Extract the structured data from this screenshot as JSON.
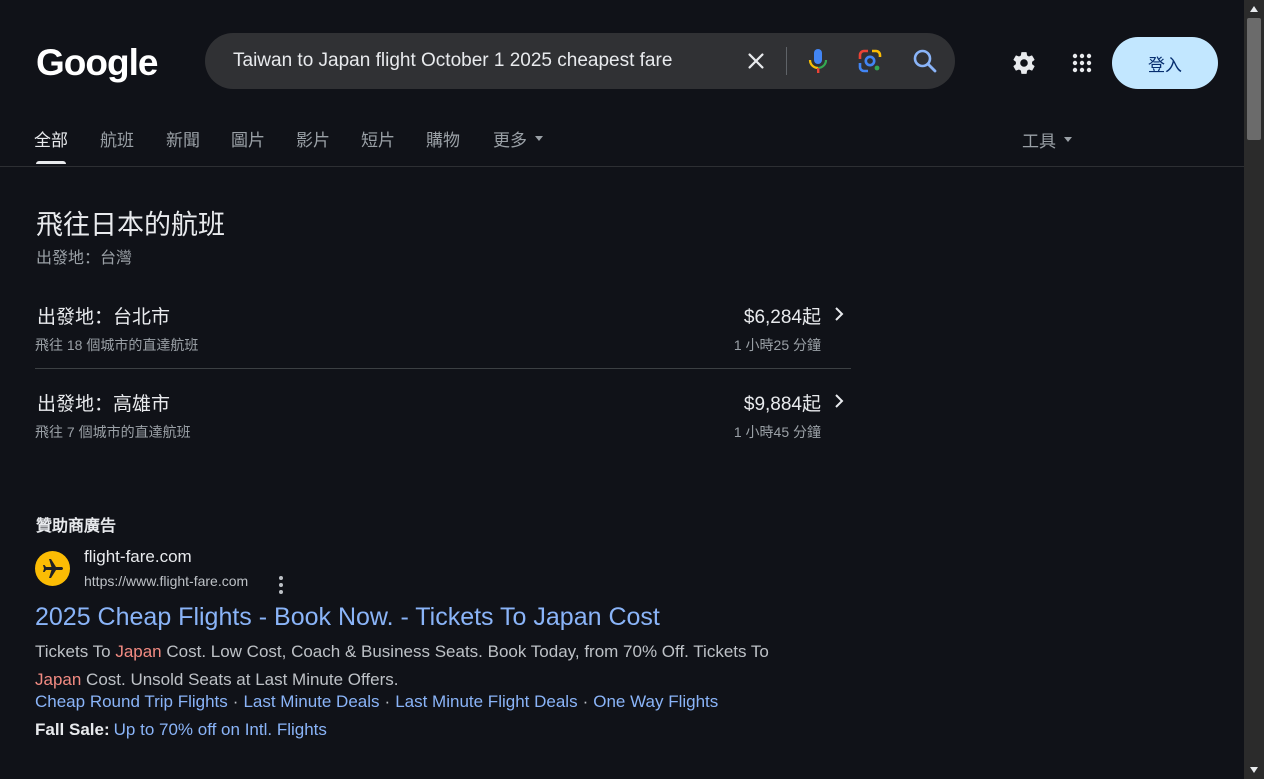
{
  "header": {
    "logo": "Google",
    "search_query": "Taiwan to Japan flight October 1 2025 cheapest fare",
    "signin_label": "登入"
  },
  "tabs": [
    {
      "label": "全部",
      "active": true
    },
    {
      "label": "航班"
    },
    {
      "label": "新聞"
    },
    {
      "label": "圖片"
    },
    {
      "label": "影片"
    },
    {
      "label": "短片"
    },
    {
      "label": "購物"
    },
    {
      "label": "更多"
    }
  ],
  "tools_label": "工具",
  "flights": {
    "title": "飛往日本的航班",
    "subtitle": "出發地：台灣",
    "rows": [
      {
        "title": "出發地：台北市",
        "sub": "飛往 18 個城市的直達航班",
        "price": "$6,284起",
        "duration": "1 小時25 分鐘"
      },
      {
        "title": "出發地：高雄市",
        "sub": "飛往 7 個城市的直達航班",
        "price": "$9,884起",
        "duration": "1 小時45 分鐘"
      }
    ]
  },
  "ad": {
    "label": "贊助商廣告",
    "site_name": "flight-fare.com",
    "url": "https://www.flight-fare.com",
    "headline": "2025 Cheap Flights - Book Now. - Tickets To Japan Cost",
    "desc_1": "Tickets To ",
    "desc_hl_1": "Japan",
    "desc_2": " Cost. Low Cost, Coach & Business Seats. Book Today, from 70% Off. Tickets To ",
    "desc_hl_2": "Japan",
    "desc_3": " Cost. Unsold Seats at Last Minute Offers.",
    "sitelinks": [
      "Cheap Round Trip Flights",
      "Last Minute Deals",
      "Last Minute Flight Deals",
      "One Way Flights"
    ],
    "separator": "·",
    "promo_label": "Fall Sale:",
    "promo_link": "Up to 70% off on Intl. Flights"
  },
  "colors": {
    "background": "#101218",
    "link": "#8ab4f8",
    "highlight": "#f28b82",
    "signin_bg": "#c2e7ff"
  }
}
